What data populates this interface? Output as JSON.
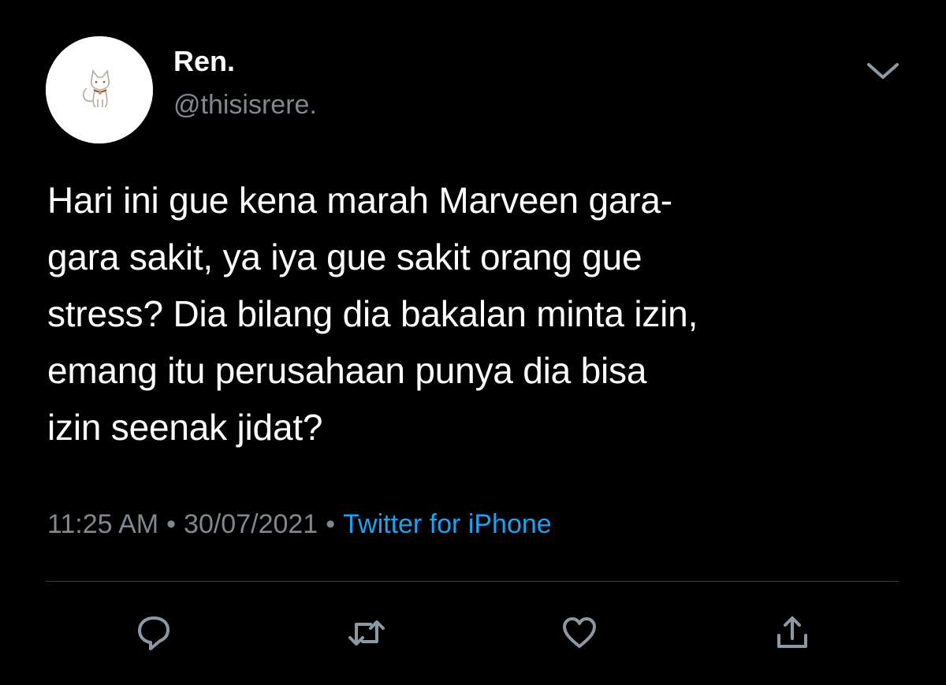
{
  "tweet": {
    "author": {
      "display_name": "Ren.",
      "handle": "@thisisrere."
    },
    "text": "Hari ini gue kena marah Marveen gara-\ngara sakit, ya iya gue sakit orang gue\nstress? Dia bilang dia bakalan minta izin,\nemang itu perusahaan punya dia bisa\nizin seenak jidat?",
    "time": "11:25 AM",
    "separator": "•",
    "date": "30/07/2021",
    "source": "Twitter for iPhone"
  },
  "icons": {
    "menu": "chevron-down-icon",
    "reply": "reply-icon",
    "retweet": "retweet-icon",
    "like": "heart-icon",
    "share": "share-icon"
  },
  "colors": {
    "background": "#000000",
    "text": "#ffffff",
    "secondary_text": "#7f8790",
    "link": "#1da1f2",
    "divider": "#3a3f44",
    "icon": "#8b98a5"
  }
}
